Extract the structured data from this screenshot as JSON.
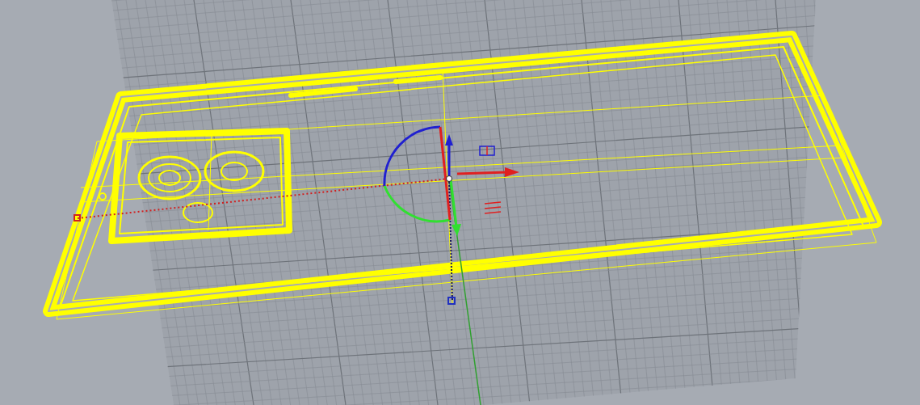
{
  "viewport": {
    "grid": true,
    "gumball": true
  }
}
